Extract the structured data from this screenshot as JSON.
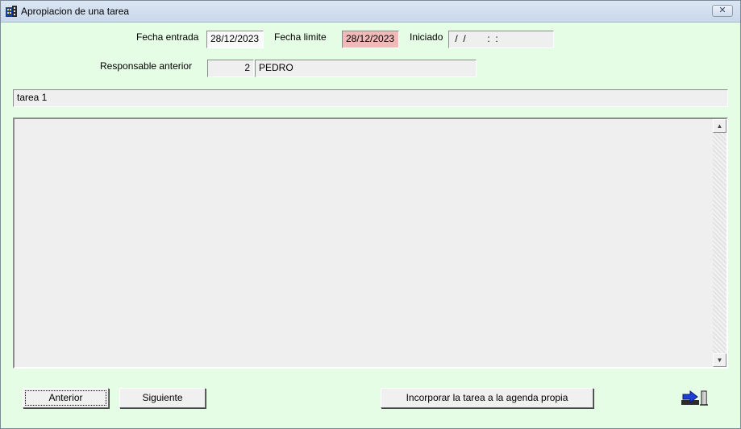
{
  "window": {
    "title": "Apropiacion de una tarea",
    "icon": "app-building-icon",
    "close_icon": "close-icon"
  },
  "form": {
    "fecha_entrada_label": "Fecha entrada",
    "fecha_entrada_value": "28/12/2023",
    "fecha_limite_label": "Fecha limite",
    "fecha_limite_value": "28/12/2023",
    "iniciado_label": "Iniciado",
    "iniciado_value": " /  /        :  :",
    "responsable_label": "Responsable anterior",
    "responsable_id": "2",
    "responsable_name": "PEDRO",
    "task_title": "tarea 1",
    "description": ""
  },
  "buttons": {
    "anterior": "Anterior",
    "siguiente": "Siguiente",
    "incorporar": "Incorporar la tarea a la agenda propia",
    "exit_icon": "exit-door-icon"
  },
  "colors": {
    "background": "#e5fde5",
    "deadline_highlight": "#f2b9b9",
    "titlebar": "#c9d8ea"
  }
}
